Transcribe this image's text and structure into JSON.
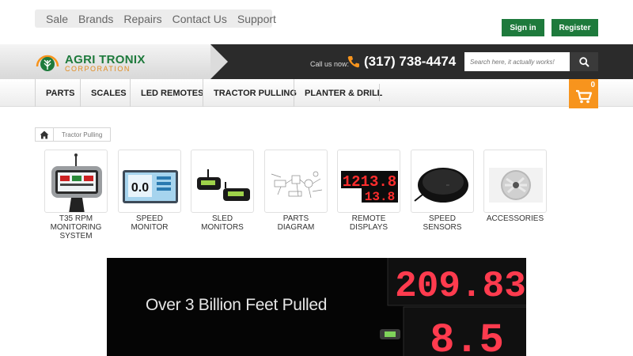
{
  "topnav": {
    "links": [
      "Sale",
      "Brands",
      "Repairs",
      "Contact Us",
      "Support"
    ]
  },
  "account": {
    "signin_label": "Sign in",
    "register_label": "Register"
  },
  "header": {
    "brand_name": "AGRI TRONIX",
    "brand_sub": "CORPORATION",
    "callus_label": "Call us now:",
    "phone": "(317) 738-4474",
    "search_placeholder": "Search here, it actually works!"
  },
  "catnav": {
    "items": [
      "PARTS",
      "SCALES",
      "LED REMOTES",
      "TRACTOR PULLING",
      "PLANTER & DRILL"
    ],
    "cart_count": "0"
  },
  "breadcrumb": {
    "current": "Tractor Pulling"
  },
  "tiles": [
    {
      "label": "T35 RPM MONITORING SYSTEM",
      "icon": "rpm-monitor-image"
    },
    {
      "label": "SPEED MONITOR",
      "icon": "speed-monitor-image"
    },
    {
      "label": "SLED MONITORS",
      "icon": "sled-monitors-image"
    },
    {
      "label": "PARTS DIAGRAM",
      "icon": "parts-diagram-image"
    },
    {
      "label": "REMOTE DISPLAYS",
      "icon": "remote-displays-image"
    },
    {
      "label": "SPEED SENSORS",
      "icon": "speed-sensor-image"
    },
    {
      "label": "ACCESSORIES",
      "icon": "accessories-image"
    }
  ],
  "tile_images": {
    "speed_readout": "0.0",
    "remote_top": "1213.8",
    "remote_bottom": "13.8"
  },
  "banner": {
    "headline": "Over 3 Billion Feet Pulled",
    "display_top": "209.83",
    "display_bottom": "8.5"
  },
  "colors": {
    "brand_green": "#1e7a3c",
    "accent_orange": "#f7941d",
    "header_dark": "#2b2b2b",
    "led_red": "#ff3b4e"
  }
}
